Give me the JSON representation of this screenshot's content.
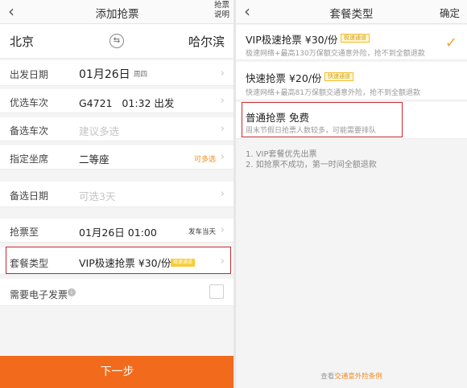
{
  "left": {
    "header": {
      "back_icon": "‹",
      "title": "添加抢票",
      "right_line1": "抢票",
      "right_line2": "说明"
    },
    "route": {
      "from": "北京",
      "to": "哈尔滨",
      "swap_icon": "⇆"
    },
    "rows": {
      "date": {
        "label": "出发日期",
        "value": "01月26日",
        "weekday": "周四"
      },
      "train": {
        "label": "优选车次",
        "value": "G4721   01:32 出发"
      },
      "alt_train": {
        "label": "备选车次",
        "placeholder": "建议多选"
      },
      "seat": {
        "label": "指定坐席",
        "value": "二等座",
        "hint": "可多选"
      },
      "alt_date": {
        "label": "备选日期",
        "placeholder": "可选3天"
      },
      "grab_until": {
        "label": "抢票至",
        "value": "01月26日 01:00",
        "hint": "发车当天"
      },
      "package": {
        "label": "套餐类型",
        "value": "VIP极速抢票 ¥30/份",
        "badge": "极速通道"
      },
      "invoice": {
        "label": "需要电子发票",
        "info_icon": "i"
      }
    },
    "next_button": "下一步"
  },
  "right": {
    "header": {
      "back_icon": "‹",
      "title": "套餐类型",
      "confirm": "确定"
    },
    "options": [
      {
        "name": "VIP极速抢票 ¥30/份",
        "badge": "极速通道",
        "desc": "极速网络+最高130万保额交通意外险，抢不到全额退款",
        "selected": true
      },
      {
        "name": "快速抢票 ¥20/份",
        "badge": "快速通道",
        "desc": "快速网络+最高81万保额交通意外险，抢不到全额退款",
        "selected": false
      },
      {
        "name": "普通抢票 免费",
        "desc": "周末节假日抢票人数较多，可能需要排队",
        "selected": false
      }
    ],
    "check_icon": "✓",
    "notes": [
      "1. VIP套餐优先出票",
      "2. 如抢票不成功，第一时间全额退款"
    ],
    "footer": {
      "prefix": "查看",
      "link": "交通意外险条例"
    }
  },
  "colors": {
    "accent_orange": "#f26a1b",
    "highlight_red": "#c8282c",
    "badge_yellow": "#f7cc36",
    "link_orange": "#f08a1c"
  }
}
